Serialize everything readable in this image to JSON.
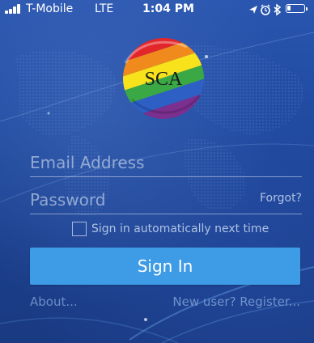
{
  "status_bar": {
    "carrier": "T-Mobile",
    "network": "LTE",
    "time": "1:04 PM",
    "battery_level": 0.2,
    "icons": [
      "location-arrow-icon",
      "alarm-clock-icon",
      "bluetooth-icon",
      "battery-icon"
    ]
  },
  "logo": {
    "text": "SCA"
  },
  "login": {
    "email_placeholder": "Email Address",
    "email_value": "",
    "password_placeholder": "Password",
    "password_value": "",
    "forgot_label": "Forgot?",
    "remember_label": "Sign in automatically next time",
    "remember_checked": false,
    "signin_label": "Sign In"
  },
  "footer": {
    "about_label": "About...",
    "register_label": "New user? Register..."
  },
  "colors": {
    "background": "#1f4a9f",
    "button": "#3e9be6",
    "link": "#789bd2"
  }
}
